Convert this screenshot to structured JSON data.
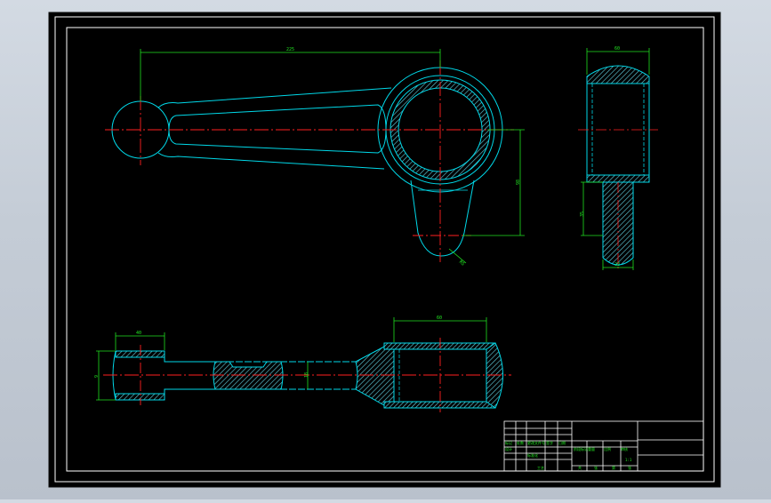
{
  "drawing": {
    "title": "",
    "colors": {
      "background": "#000000",
      "outline": "#00d8e8",
      "centerline": "#ff2020",
      "dimension": "#20e020",
      "hatch": "#60c8d8",
      "frame": "#ffffff"
    }
  },
  "dimensions": {
    "top_length": "225",
    "vertical_offset": "98",
    "radius": "R5",
    "side_width": "60",
    "side_height": "35",
    "side_bottom": "22",
    "section_left_width": "40",
    "section_left_height": "9",
    "section_mid_height": "18",
    "section_right_width": "60"
  },
  "title_block": {
    "cells": [
      "标记",
      "处数",
      "更改文件号",
      "签字",
      "日期",
      "设计",
      "标准化",
      "阶段标记",
      "重量",
      "比例",
      "审核",
      "工艺",
      "共",
      "张",
      "第",
      "张",
      "1:1"
    ]
  }
}
